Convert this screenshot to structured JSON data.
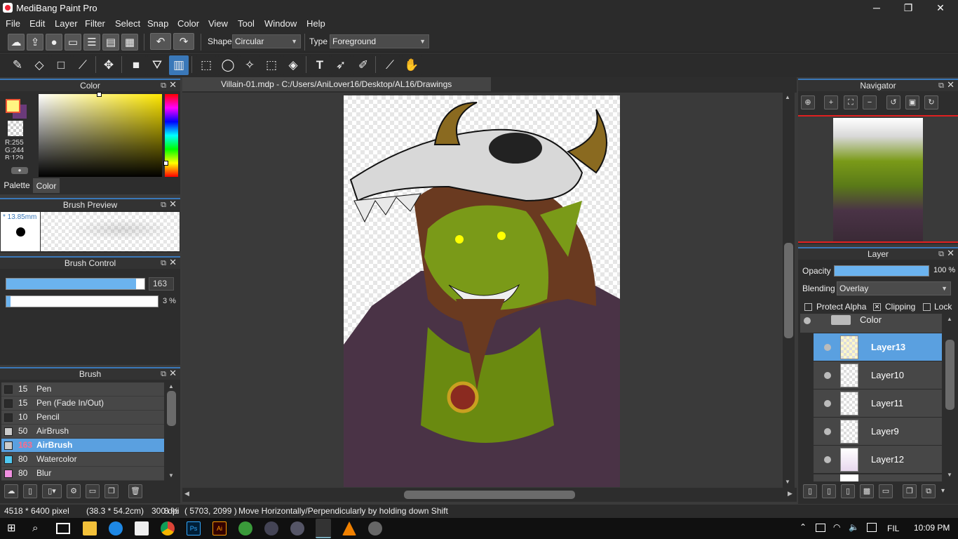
{
  "app": {
    "title": "MediBang Paint Pro"
  },
  "window_controls": {
    "minimize": "─",
    "maximize": "❐",
    "close": "✕"
  },
  "menu": [
    "File",
    "Edit",
    "Layer",
    "Filter",
    "Select",
    "Snap",
    "Color",
    "View",
    "Tool",
    "Window",
    "Help"
  ],
  "toolbar": {
    "shape_label": "Shape",
    "shape_value": "Circular",
    "type_label": "Type",
    "type_value": "Foreground"
  },
  "document": {
    "tab": "Villain-01.mdp - C:/Users/AniLover16/Desktop/AL16/Drawings"
  },
  "color_panel": {
    "title": "Color",
    "r": "R:255",
    "g": "G:244",
    "b": "B:129",
    "tab_palette": "Palette",
    "tab_color": "Color",
    "foreground": "#fff481",
    "background": "#6a3a7a"
  },
  "brush_preview": {
    "title": "Brush Preview",
    "size": "13.85mm"
  },
  "brush_control": {
    "title": "Brush Control",
    "size_value": "163",
    "size_fill": 0.94,
    "opacity_value": "3 %",
    "opacity_fill": 0.03
  },
  "brush_panel": {
    "title": "Brush",
    "items": [
      {
        "size": "15",
        "name": "Pen",
        "color": "#2a2a2a"
      },
      {
        "size": "15",
        "name": "Pen (Fade In/Out)",
        "color": "#2a2a2a"
      },
      {
        "size": "10",
        "name": "Pencil",
        "color": "#2a2a2a"
      },
      {
        "size": "50",
        "name": "AirBrush",
        "color": "#cccccc"
      },
      {
        "size": "163",
        "name": "AirBrush",
        "color": "#cccccc"
      },
      {
        "size": "80",
        "name": "Watercolor",
        "color": "#4fc8f0"
      },
      {
        "size": "80",
        "name": "Blur",
        "color": "#f090e0"
      }
    ],
    "selected_index": 4
  },
  "navigator": {
    "title": "Navigator"
  },
  "layer_panel": {
    "title": "Layer",
    "opacity_label": "Opacity",
    "opacity_value": "100 %",
    "opacity_fill": 1.0,
    "blending_label": "Blending",
    "blending_value": "Overlay",
    "protect_alpha": "Protect Alpha",
    "clipping": "Clipping",
    "lock": "Lock",
    "folder_name": "Color",
    "layers": [
      "Layer13",
      "Layer10",
      "Layer11",
      "Layer9",
      "Layer12"
    ],
    "selected_index": 0
  },
  "status": {
    "size": "4518 * 6400 pixel",
    "cm": "(38.3 * 54.2cm)",
    "dpi": "300 dpi",
    "zoom": "8 %",
    "coords": "( 5703, 2099 )",
    "hint": "Move Horizontally/Perpendicularly by holding down Shift"
  },
  "taskbar": {
    "lang": "FIL",
    "time": "10:09 PM"
  }
}
